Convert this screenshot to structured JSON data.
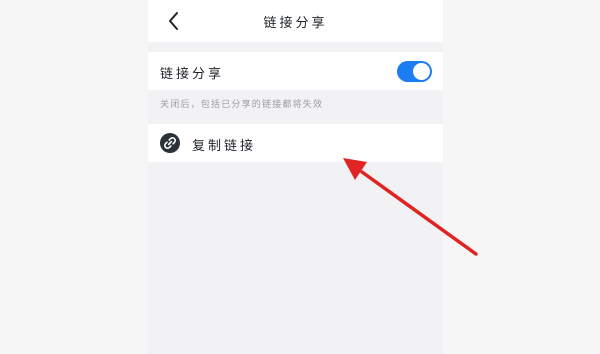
{
  "header": {
    "title": "链接分享",
    "back_icon": "chevron-left-icon"
  },
  "share_toggle": {
    "label": "链接分享",
    "enabled": true,
    "accent_color": "#1c7cf2"
  },
  "hint": {
    "text": "关闭后，包括已分享的链接都将失效"
  },
  "copy_link": {
    "icon": "link-icon",
    "label": "复制链接"
  },
  "annotation": {
    "arrow_color": "#e02424"
  }
}
